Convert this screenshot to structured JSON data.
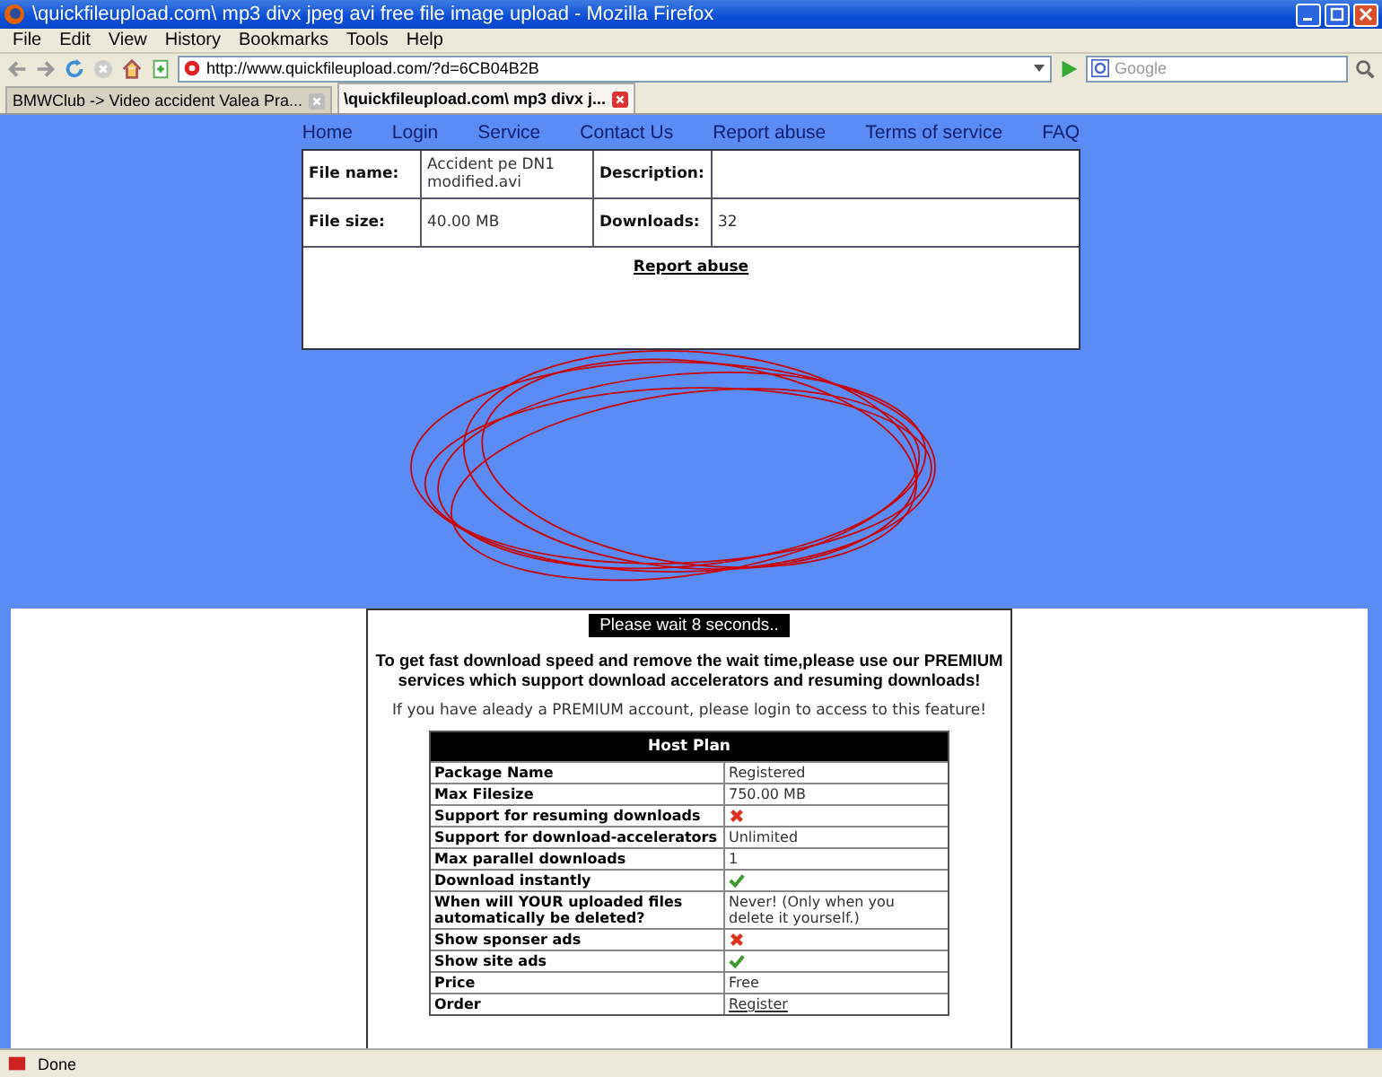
{
  "window": {
    "title": "\\quickfileupload.com\\ mp3 divx jpeg avi free file image upload - Mozilla Firefox"
  },
  "menu": [
    "File",
    "Edit",
    "View",
    "History",
    "Bookmarks",
    "Tools",
    "Help"
  ],
  "address_bar": {
    "value": "http://www.quickfileupload.com/?d=6CB04B2B"
  },
  "search": {
    "placeholder": "Google"
  },
  "tabs": [
    {
      "label": "BMWClub -> Video accident Valea Pra...",
      "selected": false
    },
    {
      "label": "\\quickfileupload.com\\ mp3 divx j...",
      "selected": true
    }
  ],
  "nav": [
    "Home",
    "Login",
    "Service",
    "Contact Us",
    "Report abuse",
    "Terms of service",
    "FAQ"
  ],
  "file_info": {
    "name_label": "File name:",
    "name": "Accident pe DN1 modified.avi",
    "description_label": "Description:",
    "size_label": "File size:",
    "size": "40.00 MB",
    "downloads_label": "Downloads:",
    "downloads": "32",
    "report_link": "Report abuse"
  },
  "countdown": "Please wait 8 seconds..",
  "promo": "To get fast download speed and remove the wait time,please use our **PREMIUM** services which support download accelerators and resuming downloads!",
  "login_note": "If you have aleady a PREMIUM account, please login to access to this feature!",
  "plan": {
    "title": "Host Plan",
    "rows": [
      {
        "label": "Package Name",
        "kind": "text",
        "value": "Registered"
      },
      {
        "label": "Max Filesize",
        "kind": "text",
        "value": "750.00 MB"
      },
      {
        "label": "Support for resuming downloads",
        "kind": "cross"
      },
      {
        "label": "Support for download-accelerators",
        "kind": "text",
        "value": "Unlimited"
      },
      {
        "label": "Max parallel downloads",
        "kind": "text",
        "value": "1"
      },
      {
        "label": "Download instantly",
        "kind": "check"
      },
      {
        "label": "When will YOUR uploaded files automatically be deleted?",
        "kind": "text",
        "value": "Never! (Only when you delete it yourself.)"
      },
      {
        "label": "Show sponser ads",
        "kind": "cross"
      },
      {
        "label": "Show site ads",
        "kind": "check"
      },
      {
        "label": "Price",
        "kind": "text",
        "value": "Free"
      },
      {
        "label": "Order",
        "kind": "link",
        "value": "Register"
      }
    ]
  },
  "status_bar": {
    "text": "Done"
  }
}
